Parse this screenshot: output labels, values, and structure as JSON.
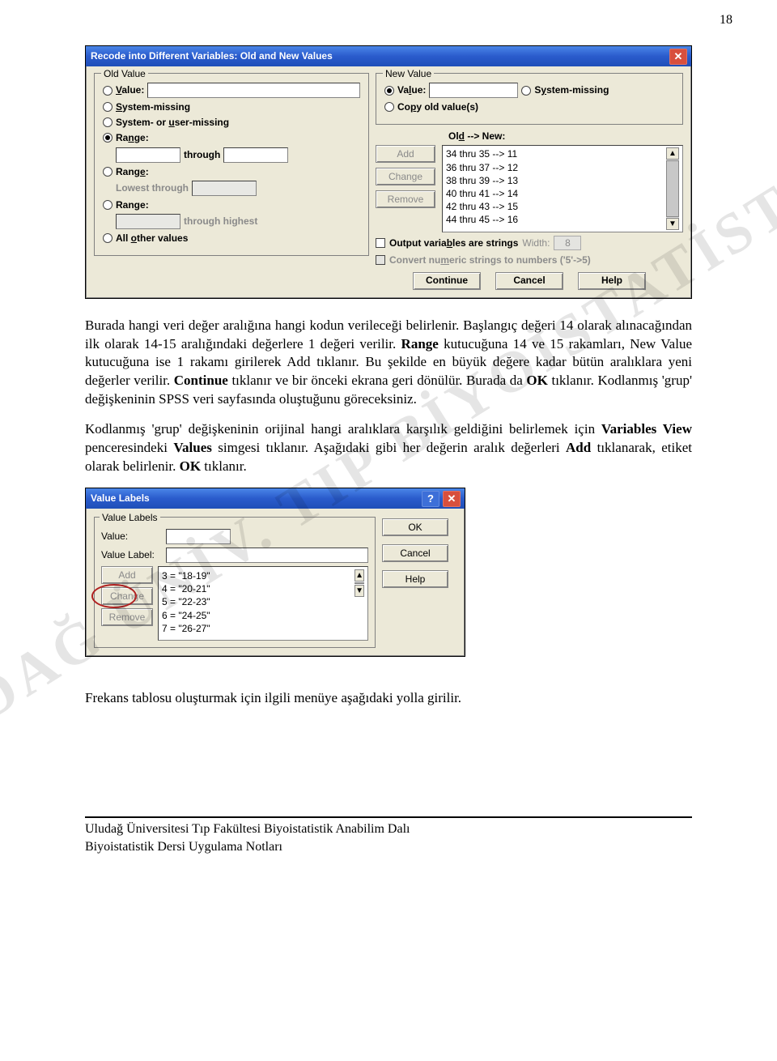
{
  "page_number": "18",
  "watermark": "ULUDAĞ ÜNİV. TIP BİYOİSTATİSTİK A.D.",
  "dlg1": {
    "title": "Recode into Different Variables: Old and New Values",
    "old": {
      "group": "Old Value",
      "value": "Value:",
      "system_missing": "System-missing",
      "system_user_missing": "System- or user-missing",
      "range": "Range:",
      "through": "through",
      "range_lowest": "Range:",
      "lowest_through": "Lowest through",
      "range_highest": "Range:",
      "through_highest": "through highest",
      "all_other": "All other values"
    },
    "new": {
      "group": "New Value",
      "value": "Value:",
      "system_missing": "System-missing",
      "copy_old": "Copy old value(s)",
      "old_new": "Old --> New:",
      "add": "Add",
      "change": "Change",
      "remove": "Remove",
      "list": [
        "34 thru 35 --> 11",
        "36 thru 37 --> 12",
        "38 thru 39 --> 13",
        "40 thru 41 --> 14",
        "42 thru 43 --> 15",
        "44 thru 45 --> 16"
      ],
      "out_strings": "Output variables are strings",
      "width": "Width:",
      "width_val": "8",
      "convert": "Convert numeric strings to numbers ('5'->5)",
      "continue": "Continue",
      "cancel": "Cancel",
      "help": "Help"
    }
  },
  "para1_a": "Burada hangi veri değer aralığına hangi kodun verileceği belirlenir. Başlangıç değeri 14 olarak alınacağından ilk olarak 14-15 aralığındaki değerlere 1 değeri verilir. ",
  "para1_range": "Range",
  "para1_b": " kutucuğuna 14 ve 15 rakamları, New Value kutucuğuna ise 1 rakamı girilerek Add tıklanır. Bu şekilde en büyük değere kadar bütün aralıklara yeni değerler verilir. ",
  "para1_cont": "Continue",
  "para1_c": " tıklanır ve bir önceki ekrana geri dönülür. Burada da ",
  "para1_ok": "OK",
  "para1_d": " tıklanır. Kodlanmış 'grup' değişkeninin SPSS veri sayfasında oluştuğunu göreceksiniz.",
  "para2_a": "Kodlanmış 'grup' değişkeninin orijinal hangi aralıklara karşılık geldiğini belirlemek için ",
  "para2_vv": "Variables View",
  "para2_b": "  penceresindeki ",
  "para2_vals": "Values",
  "para2_c": " simgesi tıklanır. Aşağıdaki gibi her değerin aralık değerleri ",
  "para2_add": "Add",
  "para2_d": " tıklanarak, etiket olarak belirlenir. ",
  "para2_ok": "OK",
  "para2_e": " tıklanır.",
  "dlg2": {
    "title": "Value Labels",
    "group": "Value Labels",
    "value": "Value:",
    "value_label": "Value Label:",
    "add": "Add",
    "change": "Change",
    "remove": "Remove",
    "ok": "OK",
    "cancel": "Cancel",
    "help": "Help",
    "list": [
      "3 = \"18-19\"",
      "4 = \"20-21\"",
      "5 = \"22-23\"",
      "6 = \"24-25\"",
      "7 = \"26-27\""
    ]
  },
  "para3": "Frekans tablosu oluşturmak için ilgili menüye aşağıdaki yolla girilir.",
  "footer1": "Uludağ Üniversitesi Tıp Fakültesi Biyoistatistik Anabilim Dalı",
  "footer2": "Biyoistatistik Dersi Uygulama Notları"
}
